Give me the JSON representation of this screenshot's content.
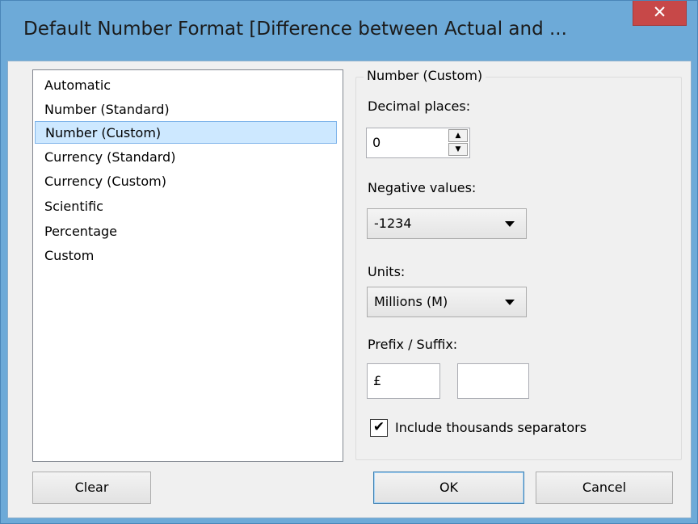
{
  "window": {
    "title": "Default Number Format [Difference between Actual and ...",
    "close_glyph": "✕"
  },
  "format_list": {
    "items": [
      {
        "label": "Automatic",
        "selected": false
      },
      {
        "label": "Number (Standard)",
        "selected": false
      },
      {
        "label": "Number (Custom)",
        "selected": true
      },
      {
        "label": "Currency (Standard)",
        "selected": false
      },
      {
        "label": "Currency (Custom)",
        "selected": false
      },
      {
        "label": "Scientific",
        "selected": false
      },
      {
        "label": "Percentage",
        "selected": false
      },
      {
        "label": "Custom",
        "selected": false
      }
    ]
  },
  "options": {
    "group_title": "Number (Custom)",
    "decimal_places_label": "Decimal places:",
    "decimal_places_value": "0",
    "negative_values_label": "Negative values:",
    "negative_values_selected": "-1234",
    "units_label": "Units:",
    "units_selected": "Millions (M)",
    "prefix_suffix_label": "Prefix / Suffix:",
    "prefix_value": "£",
    "suffix_value": "",
    "thousands_separator_label": "Include thousands separators",
    "thousands_separator_checked": true,
    "check_glyph": "✔"
  },
  "buttons": {
    "clear": "Clear",
    "ok": "OK",
    "cancel": "Cancel"
  },
  "colors": {
    "title_bar": "#6daad8",
    "close_button": "#c74848",
    "selection": "#cde8ff",
    "dialog_background": "#f0f0f0"
  }
}
